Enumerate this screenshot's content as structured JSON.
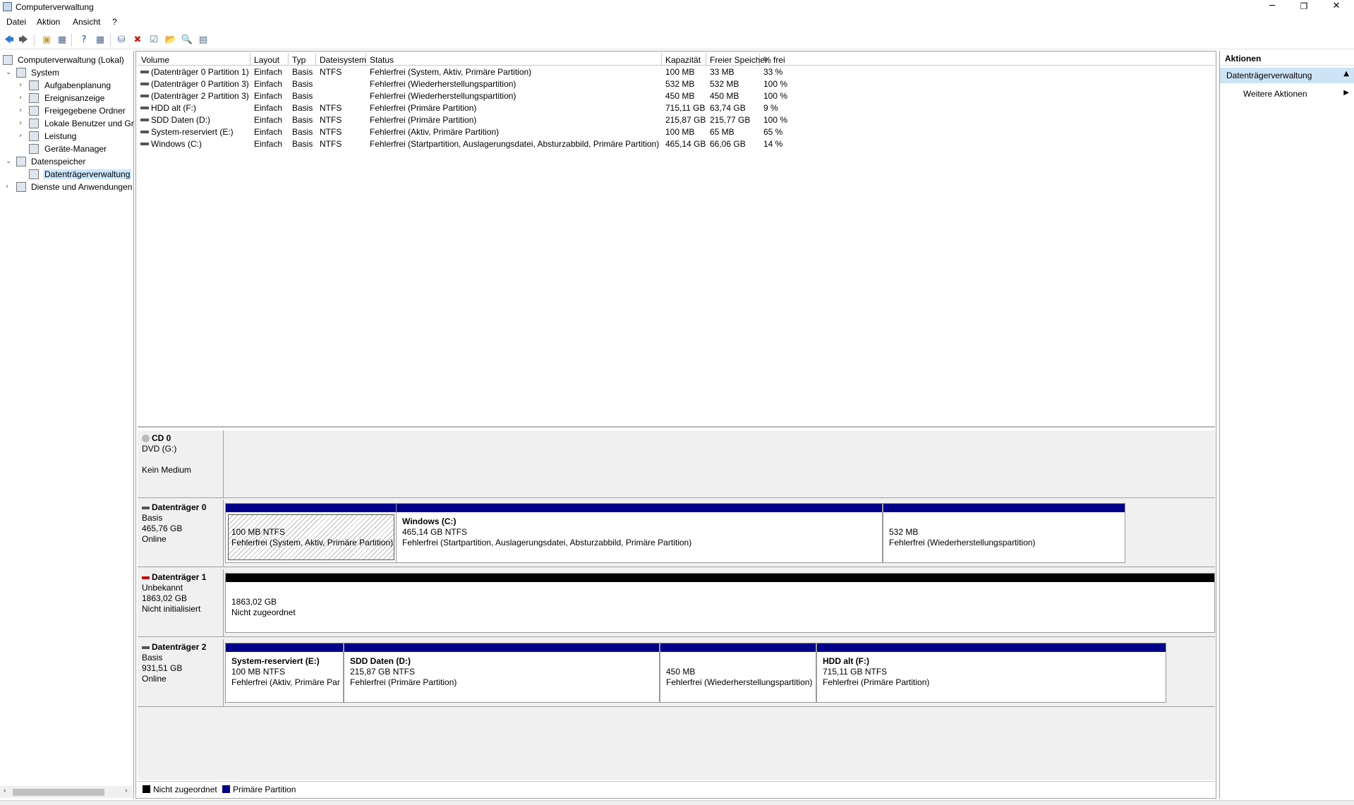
{
  "window": {
    "title": "Computerverwaltung",
    "minimize": "─",
    "restore": "❐",
    "close": "✕"
  },
  "menu": [
    "Datei",
    "Aktion",
    "Ansicht",
    "?"
  ],
  "toolbar": [
    {
      "name": "back-icon",
      "glyph": "🡄",
      "color": "#2b7bd3"
    },
    {
      "name": "forward-icon",
      "glyph": "🡆",
      "color": "#5a5a5a"
    },
    {
      "name": "up-folder-icon",
      "glyph": "▣",
      "color": "#c8a033"
    },
    {
      "name": "show-hide-tree-icon",
      "glyph": "▦",
      "color": "#4a6a90"
    },
    {
      "name": "help-icon",
      "glyph": "?",
      "color": "#1e4fa0"
    },
    {
      "name": "show-hide-action-icon",
      "glyph": "▦",
      "color": "#4a6a90"
    },
    {
      "name": "connect-drive-icon",
      "glyph": "⛁",
      "color": "#4a6a90"
    },
    {
      "name": "delete-icon",
      "glyph": "✖",
      "color": "#d21b1b"
    },
    {
      "name": "check-icon",
      "glyph": "☑",
      "color": "#4a6a90"
    },
    {
      "name": "folder-open-icon",
      "glyph": "📂",
      "color": "#c8a033"
    },
    {
      "name": "folder-search-icon",
      "glyph": "🔍",
      "color": "#c8a033"
    },
    {
      "name": "properties-icon",
      "glyph": "▤",
      "color": "#4a6a90"
    }
  ],
  "tree": [
    {
      "label": "Computerverwaltung (Lokal)",
      "level": 0,
      "arrow": "",
      "icon": "computer-icon"
    },
    {
      "label": "System",
      "level": 1,
      "arrow": "⌄",
      "icon": "tools-icon"
    },
    {
      "label": "Aufgabenplanung",
      "level": 2,
      "arrow": "›",
      "icon": "clock-icon"
    },
    {
      "label": "Ereignisanzeige",
      "level": 2,
      "arrow": "›",
      "icon": "event-viewer-icon"
    },
    {
      "label": "Freigegebene Ordner",
      "level": 2,
      "arrow": "›",
      "icon": "shared-folder-icon"
    },
    {
      "label": "Lokale Benutzer und Gr",
      "level": 2,
      "arrow": "›",
      "icon": "users-icon"
    },
    {
      "label": "Leistung",
      "level": 2,
      "arrow": "›",
      "icon": "performance-icon"
    },
    {
      "label": "Geräte-Manager",
      "level": 2,
      "arrow": "",
      "icon": "device-manager-icon"
    },
    {
      "label": "Datenspeicher",
      "level": 1,
      "arrow": "⌄",
      "icon": "storage-icon"
    },
    {
      "label": "Datenträgerverwaltung",
      "level": 2,
      "arrow": "",
      "icon": "disk-management-icon",
      "selected": true
    },
    {
      "label": "Dienste und Anwendungen",
      "level": 1,
      "arrow": "›",
      "icon": "services-icon"
    }
  ],
  "table": {
    "headers": [
      "Volume",
      "Layout",
      "Typ",
      "Dateisystem",
      "Status",
      "Kapazität",
      "Freier Speicher",
      "% frei"
    ],
    "rows": [
      [
        "(Datenträger 0 Partition 1)",
        "Einfach",
        "Basis",
        "NTFS",
        "Fehlerfrei (System, Aktiv, Primäre Partition)",
        "100 MB",
        "33 MB",
        "33 %"
      ],
      [
        "(Datenträger 0 Partition 3)",
        "Einfach",
        "Basis",
        "",
        "Fehlerfrei (Wiederherstellungspartition)",
        "532 MB",
        "532 MB",
        "100 %"
      ],
      [
        "(Datenträger 2 Partition 3)",
        "Einfach",
        "Basis",
        "",
        "Fehlerfrei (Wiederherstellungspartition)",
        "450 MB",
        "450 MB",
        "100 %"
      ],
      [
        "HDD alt (F:)",
        "Einfach",
        "Basis",
        "NTFS",
        "Fehlerfrei (Primäre Partition)",
        "715,11 GB",
        "63,74 GB",
        "9 %"
      ],
      [
        "SDD Daten (D:)",
        "Einfach",
        "Basis",
        "NTFS",
        "Fehlerfrei (Primäre Partition)",
        "215,87 GB",
        "215,77 GB",
        "100 %"
      ],
      [
        "System-reserviert (E:)",
        "Einfach",
        "Basis",
        "NTFS",
        "Fehlerfrei (Aktiv, Primäre Partition)",
        "100 MB",
        "65 MB",
        "65 %"
      ],
      [
        "Windows (C:)",
        "Einfach",
        "Basis",
        "NTFS",
        "Fehlerfrei (Startpartition, Auslagerungsdatei, Absturzabbild, Primäre Partition)",
        "465,14 GB",
        "66,06 GB",
        "14 %"
      ]
    ]
  },
  "disks": [
    {
      "name": "CD 0",
      "lines": [
        "DVD (G:)",
        "",
        "Kein Medium"
      ],
      "icon": "cd-icon",
      "partitions": []
    },
    {
      "name": "Datenträger 0",
      "lines": [
        "Basis",
        "465,76 GB",
        "Online"
      ],
      "icon": "disk-icon",
      "partitions": [
        {
          "title": "",
          "lines": [
            "100 MB NTFS",
            "Fehlerfrei (System, Aktiv, Primäre Partition)"
          ],
          "selected": true
        },
        {
          "title": "Windows  (C:)",
          "lines": [
            "465,14 GB NTFS",
            "Fehlerfrei (Startpartition, Auslagerungsdatei, Absturzabbild, Primäre Partition)"
          ]
        },
        {
          "title": "",
          "lines": [
            "532 MB",
            "Fehlerfrei (Wiederherstellungspartition)"
          ]
        }
      ]
    },
    {
      "name": "Datenträger 1",
      "lines": [
        "Unbekannt",
        "1863,02 GB",
        "Nicht initialisiert"
      ],
      "icon": "disk-error-icon",
      "partitions": [
        {
          "title": "",
          "lines": [
            "1863,02 GB",
            "Nicht zugeordnet"
          ],
          "unallocated": true
        }
      ]
    },
    {
      "name": "Datenträger 2",
      "lines": [
        "Basis",
        "931,51 GB",
        "Online"
      ],
      "icon": "disk-icon",
      "partitions": [
        {
          "title": "System-reserviert  (E:)",
          "lines": [
            "100 MB NTFS",
            "Fehlerfrei (Aktiv, Primäre Partition)"
          ]
        },
        {
          "title": "SDD Daten  (D:)",
          "lines": [
            "215,87 GB NTFS",
            "Fehlerfrei (Primäre Partition)"
          ]
        },
        {
          "title": "",
          "lines": [
            "450 MB",
            "Fehlerfrei (Wiederherstellungspartition)"
          ]
        },
        {
          "title": "HDD alt  (F:)",
          "lines": [
            "715,11 GB NTFS",
            "Fehlerfrei (Primäre Partition)"
          ]
        }
      ]
    }
  ],
  "legend": [
    {
      "label": "Nicht zugeordnet",
      "color": "#000000"
    },
    {
      "label": "Primäre Partition",
      "color": "#00008b"
    }
  ],
  "actions": {
    "header": "Aktionen",
    "section": "Datenträgerverwaltung",
    "section_caret": "▲",
    "item": "Weitere Aktionen",
    "item_caret": "▶"
  },
  "colors": {
    "primary_partition": "#00008b",
    "unallocated": "#000000",
    "selection": "#cde4f7"
  }
}
